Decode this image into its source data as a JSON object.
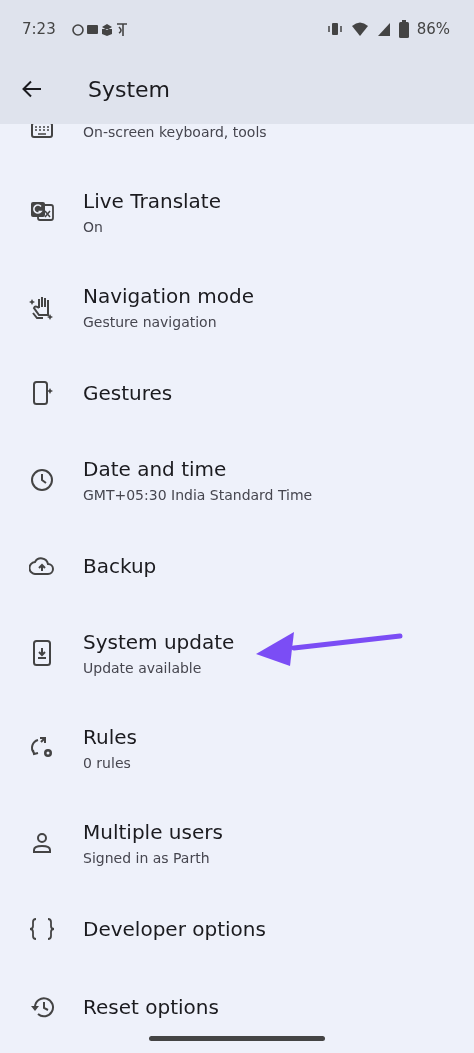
{
  "status_bar": {
    "time": "7:23",
    "battery": "86%"
  },
  "app_bar": {
    "title": "System"
  },
  "items": [
    {
      "kind": "keyboard",
      "subtitle": "On-screen keyboard, tools"
    },
    {
      "kind": "translate",
      "title": "Live Translate",
      "subtitle": "On"
    },
    {
      "kind": "navigation",
      "title": "Navigation mode",
      "subtitle": "Gesture navigation"
    },
    {
      "kind": "gestures",
      "title": "Gestures"
    },
    {
      "kind": "clock",
      "title": "Date and time",
      "subtitle": "GMT+05:30 India Standard Time"
    },
    {
      "kind": "backup",
      "title": "Backup"
    },
    {
      "kind": "update",
      "title": "System update",
      "subtitle": "Update available"
    },
    {
      "kind": "rules",
      "title": "Rules",
      "subtitle": "0 rules"
    },
    {
      "kind": "users",
      "title": "Multiple users",
      "subtitle": "Signed in as Parth"
    },
    {
      "kind": "developer",
      "title": "Developer options"
    },
    {
      "kind": "reset",
      "title": "Reset options"
    }
  ]
}
